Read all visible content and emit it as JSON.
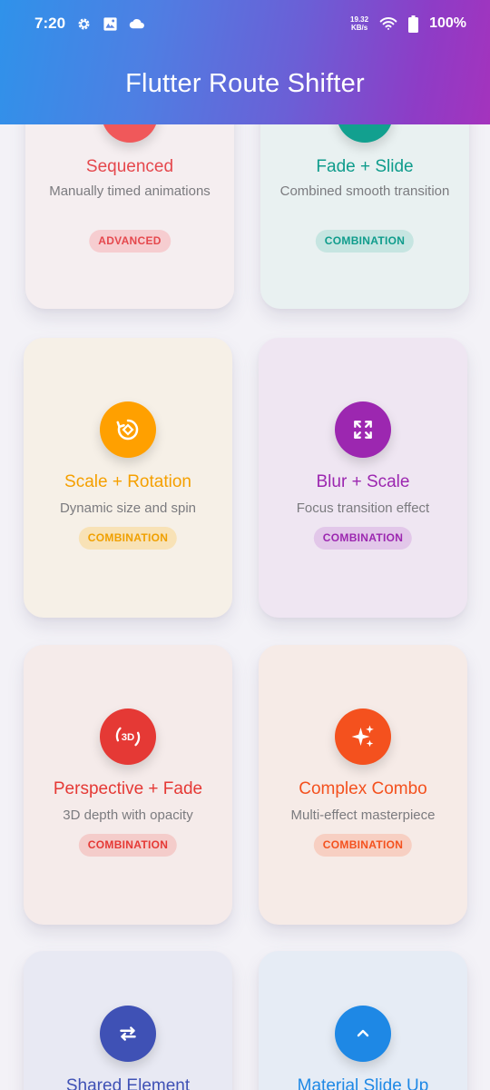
{
  "status_bar": {
    "time": "7:20",
    "net_speed_value": "19.32",
    "net_speed_unit": "KB/s",
    "battery": "100%"
  },
  "app_bar": {
    "title": "Flutter Route Shifter"
  },
  "cards": [
    {
      "title": "Sequenced",
      "description": "Manually timed animations",
      "badge": "ADVANCED",
      "icon": "sequence-icon",
      "color": "#ef4f53"
    },
    {
      "title": "Fade + Slide",
      "description": "Combined smooth transition",
      "badge": "COMBINATION",
      "icon": "fade-slide-icon",
      "color": "#0f9c8c"
    },
    {
      "title": "Scale + Rotation",
      "description": "Dynamic size and spin",
      "badge": "COMBINATION",
      "icon": "rotate-icon",
      "color": "#ffa000"
    },
    {
      "title": "Blur + Scale",
      "description": "Focus transition effect",
      "badge": "COMBINATION",
      "icon": "fullscreen-icon",
      "color": "#9c27b0"
    },
    {
      "title": "Perspective + Fade",
      "description": "3D depth with opacity",
      "badge": "COMBINATION",
      "icon": "3d-rotation-icon",
      "color": "#e53935"
    },
    {
      "title": "Complex Combo",
      "description": "Multi-effect masterpiece",
      "badge": "COMBINATION",
      "icon": "sparkle-icon",
      "color": "#f4511e"
    },
    {
      "title": "Shared Element",
      "description": "",
      "badge": "",
      "icon": "swap-arrows-icon",
      "color": "#3f51b5"
    },
    {
      "title": "Material Slide Up",
      "description": "",
      "badge": "",
      "icon": "chevron-up-icon",
      "color": "#1e88e5"
    }
  ]
}
